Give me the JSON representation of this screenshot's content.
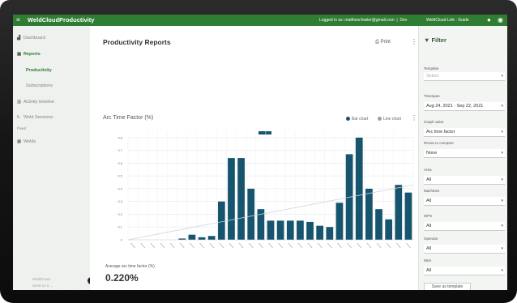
{
  "topbar": {
    "menu_icon": "≡",
    "brand": "WeldCloudProductivity",
    "logged_in": "Logged in as: matthew.fowler@gmail.com",
    "sep": "Dev",
    "link": "WeldCloud Link · Guide"
  },
  "sidebar": {
    "items": [
      {
        "label": "Dashboard",
        "icon": "chart-icon"
      },
      {
        "label": "Reports",
        "icon": "table-icon"
      },
      {
        "label": "Productivity"
      },
      {
        "label": "Subscriptions"
      },
      {
        "label": "Activity timeline",
        "icon": "timeline-icon"
      },
      {
        "label": "Weld Sessions",
        "icon": "bolt-icon"
      },
      {
        "label": "Fixed"
      },
      {
        "label": "Welds",
        "icon": "grid-icon"
      }
    ],
    "footer_line1": "WeldCloud",
    "footer_line2": "Send us a ...",
    "collapse_icon": "‹"
  },
  "main": {
    "title": "Productivity Reports",
    "print_label": "Print",
    "chart_title": "Arc Time Factor (%)",
    "view_bar": "Bar chart",
    "view_line": "Line chart",
    "card_label": "Average arc time factor (%)",
    "card_value": "0.220%"
  },
  "filter": {
    "title": "Filter",
    "fields": [
      {
        "label": "Template",
        "value": "Select",
        "placeholder": true
      },
      {
        "label": "Timespan",
        "value": "Aug 24, 2021 - Sep 22, 2021"
      },
      {
        "label": "Graph value",
        "value": "Arc time factor"
      },
      {
        "label": "Reuse to compare",
        "value": "None"
      },
      {
        "label": "Area",
        "value": "All"
      },
      {
        "label": "Machines",
        "value": "All"
      },
      {
        "label": "WPS",
        "value": "All"
      },
      {
        "label": "Operator",
        "value": "All"
      },
      {
        "label": "Wire",
        "value": "All"
      }
    ],
    "save_label": "Save as template"
  },
  "colors": {
    "brand": "#2f7d32",
    "bar": "#17556f",
    "trend": "#cfd6da"
  },
  "chart_data": {
    "type": "bar",
    "series": [
      {
        "values": [
          0,
          0,
          0,
          0,
          0,
          0.01,
          0.04,
          0.02,
          0.03,
          0.3,
          0.64,
          0.64,
          0.4,
          0.24,
          0.15,
          0.15,
          0.15,
          0.15,
          0.14,
          0.11,
          0.1,
          0.29,
          0.67,
          0.8,
          0.4,
          0.24,
          0.16,
          0.43,
          0.37
        ]
      }
    ],
    "trend": {
      "from": 0.0,
      "to": 0.43
    },
    "yticks": [
      "0",
      "0.1",
      "0.2",
      "0.3",
      "0.4",
      "0.5",
      "0.6",
      "0.7",
      "0.8"
    ],
    "ylim": [
      0,
      0.85
    ]
  }
}
